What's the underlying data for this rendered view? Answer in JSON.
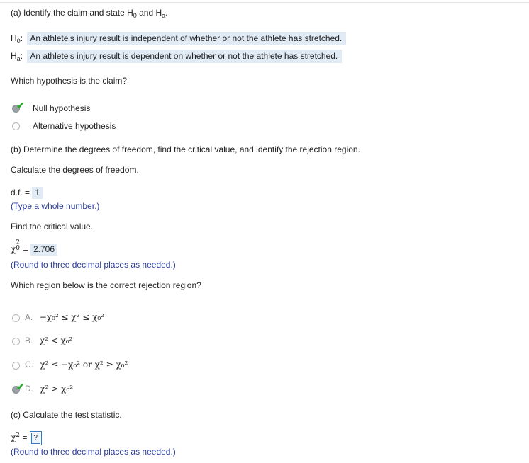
{
  "part_a": {
    "heading_pre": "(a) Identify the claim and state H",
    "heading_sub0": "0",
    "heading_mid": " and H",
    "heading_suba": "a",
    "heading_end": ".",
    "h0_label": "H",
    "h0_sub": "0",
    "h0_colon": ":",
    "h0_text": "An athlete's injury result is independent of whether or not the athlete has stretched.",
    "ha_label": "H",
    "ha_sub": "a",
    "ha_colon": ":",
    "ha_text": "An athlete's injury result is dependent on whether or not the athlete has stretched.",
    "claim_question": "Which hypothesis is the claim?",
    "options": [
      "Null hypothesis",
      "Alternative hypothesis"
    ],
    "selected_option": "Null hypothesis"
  },
  "part_b": {
    "heading": "(b) Determine the degrees of freedom, find the critical value, and identify the rejection region.",
    "df_prompt": "Calculate the degrees of freedom.",
    "df_label": "d.f. = ",
    "df_value": "1",
    "df_hint": "(Type a whole number.)",
    "cv_prompt": "Find the critical value.",
    "cv_eq": " = ",
    "cv_value": "2.706",
    "cv_hint": "(Round to three decimal places as needed.)",
    "region_prompt": "Which region below is the correct rejection region?",
    "region_options": [
      {
        "letter": "A.",
        "expr": "−χ₀² ≤ χ² ≤ χ₀²"
      },
      {
        "letter": "B.",
        "expr": "χ² < χ₀²"
      },
      {
        "letter": "C.",
        "expr": "χ² ≤ −χ₀² or χ² ≥ χ₀²"
      },
      {
        "letter": "D.",
        "expr": "χ² > χ₀²"
      }
    ],
    "selected_region": "D."
  },
  "part_c": {
    "heading": "(c) Calculate the test statistic.",
    "stat_label": " = ",
    "stat_placeholder": "?",
    "stat_hint": "(Round to three decimal places as needed.)"
  },
  "icons": {
    "check_color": "#2ea82e",
    "highlight_color": "#e1ebf6",
    "hint_color": "#2a3a9c"
  }
}
